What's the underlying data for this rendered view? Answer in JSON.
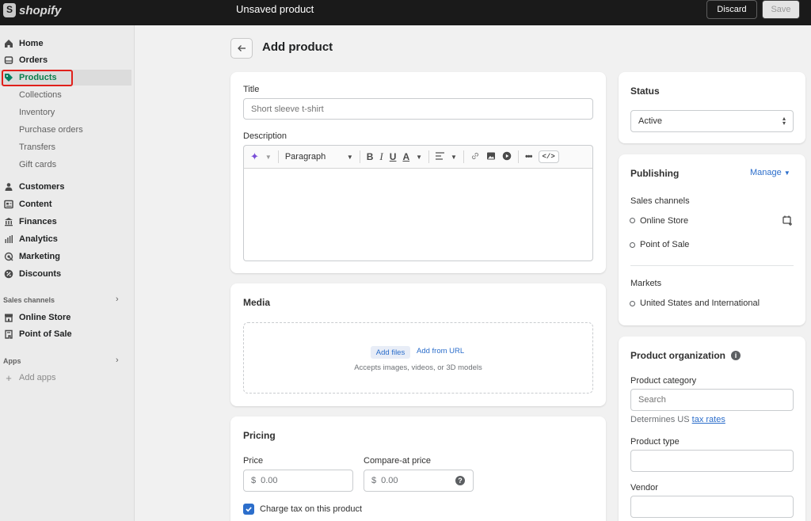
{
  "topbar": {
    "logo_text": "shopify",
    "title": "Unsaved product",
    "discard_label": "Discard",
    "save_label": "Save"
  },
  "sidebar": {
    "items": [
      {
        "label": "Home",
        "icon": "home-icon"
      },
      {
        "label": "Orders",
        "icon": "orders-icon"
      },
      {
        "label": "Products",
        "icon": "tag-icon",
        "active": true
      },
      {
        "label": "Customers",
        "icon": "person-icon"
      },
      {
        "label": "Content",
        "icon": "content-icon"
      },
      {
        "label": "Finances",
        "icon": "bank-icon"
      },
      {
        "label": "Analytics",
        "icon": "bar-chart-icon"
      },
      {
        "label": "Marketing",
        "icon": "target-icon"
      },
      {
        "label": "Discounts",
        "icon": "discount-icon"
      }
    ],
    "product_subitems": [
      "Collections",
      "Inventory",
      "Purchase orders",
      "Transfers",
      "Gift cards"
    ],
    "sales_channels_label": "Sales channels",
    "sales_channels": [
      {
        "label": "Online Store",
        "icon": "store-icon"
      },
      {
        "label": "Point of Sale",
        "icon": "pos-icon"
      }
    ],
    "apps_label": "Apps",
    "add_apps_label": "Add apps"
  },
  "page": {
    "title": "Add product"
  },
  "product": {
    "title_label": "Title",
    "title_placeholder": "Short sleeve t-shirt",
    "description_label": "Description",
    "toolbar_paragraph": "Paragraph"
  },
  "media": {
    "heading": "Media",
    "add_files": "Add files",
    "add_from_url": "Add from URL",
    "hint": "Accepts images, videos, or 3D models"
  },
  "pricing": {
    "heading": "Pricing",
    "price_label": "Price",
    "price_value": "0.00",
    "compare_label": "Compare-at price",
    "compare_value": "0.00",
    "currency": "$",
    "charge_tax_label": "Charge tax on this product",
    "charge_tax_checked": true
  },
  "status": {
    "heading": "Status",
    "value": "Active"
  },
  "publishing": {
    "heading": "Publishing",
    "manage_label": "Manage",
    "sales_channels_label": "Sales channels",
    "channels": [
      "Online Store",
      "Point of Sale"
    ],
    "markets_label": "Markets",
    "markets": [
      "United States and International"
    ]
  },
  "organization": {
    "heading": "Product organization",
    "category_label": "Product category",
    "category_placeholder": "Search",
    "tax_note_prefix": "Determines US",
    "tax_link": "tax rates",
    "type_label": "Product type",
    "vendor_label": "Vendor"
  },
  "colors": {
    "topbar": "#1a1a1a",
    "sidebar": "#ebebeb",
    "accent_blue": "#2c6ecb",
    "highlight_red": "#e0201b",
    "active_tag_green": "#008060"
  }
}
